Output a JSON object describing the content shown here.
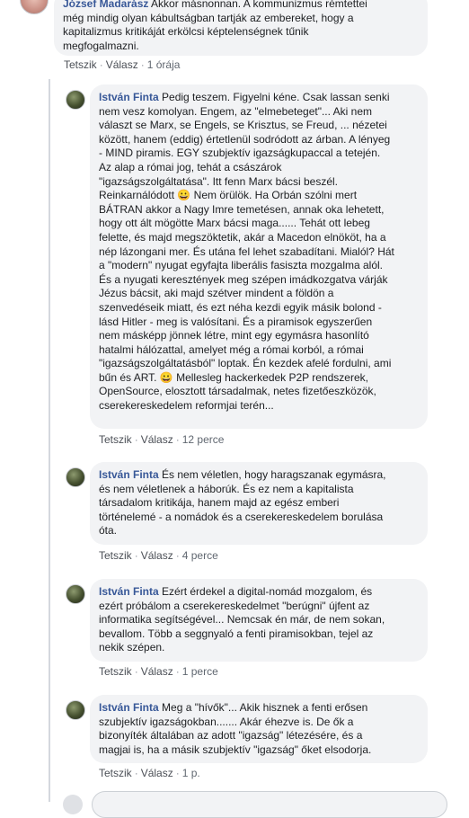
{
  "comments": [
    {
      "author": "József Madarász",
      "text": "Akkor másnonnan. A kommunizmus rémtettei\nmég mindig olyan kábultságban tartják az embereket, hogy a\nkapitalizmus kritikáját erkölcsi képtelenségnek tűnik\nmegfogalmazni.",
      "like_label": "Tetszik",
      "reply_label": "Válasz",
      "time": "1 órája"
    },
    {
      "author": "István Finta",
      "text": "Pedig teszem. Figyelni kéne. Csak lassan senki\nnem vesz komolyan. Engem, az \"elmebeteget\"... Aki nem\nválaszt se Marx, se Engels, se Krisztus, se Freud, ... nézetei\nközött, hanem (eddig) értetlenül sodródott az árban. A lényeg\n- MIND piramis. EGY szubjektív igazságkupaccal a tetején.\nAz alap a római jog, tehát a császárok\n\"igazságszolgáltatása\". Itt fenn Marx bácsi beszél.\nReinkarnálódott 😀 Nem örülök. Ha Orbán szólni mert\nBÁTRAN akkor a Nagy Imre temetésen, annak oka lehetett,\nhogy ott ált mögötte Marx bácsi maga...... Tehát ott lebeg\nfelette, és majd megszöktetik, akár a Macedon elnököt, ha a\nnép lázongani mer. És utána fel lehet szabadítani. Mialól? Hát\na \"modern\" nyugat egyfajta liberális fasiszta mozgalma alól.\nÉs a nyugati keresztények meg szépen imádkozgatva várják\nJézus bácsit, aki majd szétver mindent a földön a\nszenvedéseik miatt, és ezt néha kezdi egyik másik bolond -\nlásd Hitler - meg is valósítani. És a piramisok egyszerűen\nnem másképp jönnek létre, mint egy egymásra hasonlító\nhatalmi hálózattal, amelyet még a római korból, a római\n\"igazságszolgáltatásból\" loptak. Én kezdek afelé fordulni, ami\nbűn és ART. 😀 Mellesleg hackerkedek P2P rendszerek,\nOpenSource, elosztott társadalmak, netes fizetőeszközök,\ncserekereskedelem reformjai terén...",
      "like_label": "Tetszik",
      "reply_label": "Válasz",
      "time": "12 perce"
    },
    {
      "author": "István Finta",
      "text": "És nem véletlen, hogy haragszanak egymásra,\nés nem véletlenek a háborúk. És ez nem a kapitalista\ntársadalom kritikája, hanem majd az egész emberi\ntörténelemé - a nomádok és a cserekereskedelem borulása\nóta.",
      "like_label": "Tetszik",
      "reply_label": "Válasz",
      "time": "4 perce"
    },
    {
      "author": "István Finta",
      "text": "Ezért érdekel a digital-nomád mozgalom, és\nezért próbálom a cserekereskedelmet \"berúgni\" újfent az\ninformatika segítségével... Nemcsak én már, de nem sokan,\nbevallom. Több a seggnyaló a fenti piramisokban, tejel az\nnekik szépen.",
      "like_label": "Tetszik",
      "reply_label": "Válasz",
      "time": "1 perce"
    },
    {
      "author": "István Finta",
      "text": "Meg a \"hívők\"... Akik hisznek a fenti erősen\nszubjektív igazságokban....... Akár éhezve is. De ők a\nbizonyíték általában az adott \"igazság\" létezésére, és a\nmagjai is, ha a másik szubjektív \"igazság\" őket elsodorja.",
      "like_label": "Tetszik",
      "reply_label": "Válasz",
      "time": "1 p."
    }
  ],
  "separator": "·"
}
